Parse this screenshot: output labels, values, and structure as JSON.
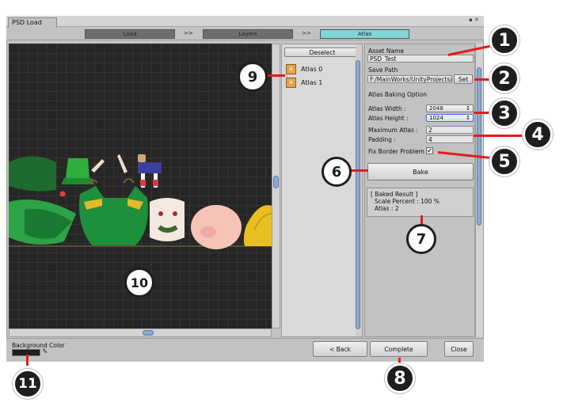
{
  "window": {
    "tab_title": "PSD Load",
    "controls": "▪ ✕"
  },
  "steps": [
    {
      "label": "Load",
      "state": "inactive"
    },
    {
      "label": "Layers",
      "state": "inactive"
    },
    {
      "label": "Atlas",
      "state": "active"
    }
  ],
  "step_separator": ">>",
  "atlas_list": {
    "deselect_label": "Deselect",
    "items": [
      {
        "label": "Atlas 0",
        "icon": "atlas-icon"
      },
      {
        "label": "Atlas 1",
        "icon": "atlas-icon"
      }
    ]
  },
  "options": {
    "asset_name_label": "Asset Name",
    "asset_name_value": "PSD_Test",
    "save_path_label": "Save Path",
    "save_path_value": "F:/MainWorks/UnityProjects/Ar",
    "set_label": "Set",
    "baking_label": "Atlas Baking Option",
    "width_label": "Atlas Width :",
    "width_value": "2048",
    "height_label": "Atlas Height :",
    "height_value": "1024",
    "max_atlas_label": "Maximum Atlas :",
    "max_atlas_value": "2",
    "padding_label": "Padding :",
    "padding_value": "4",
    "fix_border_label": "Fix Border Problem",
    "fix_border_checked": true,
    "bake_label": "Bake"
  },
  "result": {
    "line1": "[ Baked Result ]",
    "line2": "Scale Percent : 100 %",
    "line3": "Atlas : 2"
  },
  "bottom": {
    "bg_color_label": "Background Color",
    "bg_color_value": "#1e1e1e",
    "back_label": "< Back",
    "complete_label": "Complete",
    "close_label": "Close"
  },
  "callouts": [
    "1",
    "2",
    "3",
    "4",
    "5",
    "6",
    "7",
    "8",
    "9",
    "10",
    "11"
  ],
  "colors": {
    "accent_step": "#7fd6d9",
    "callout_line": "#e51b1b",
    "scroll_thumb": "#8ea9cf"
  }
}
